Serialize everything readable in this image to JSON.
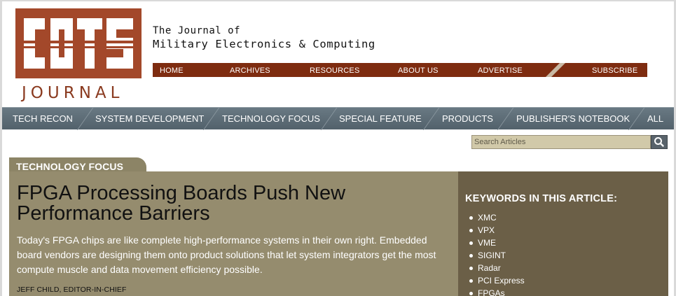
{
  "logo": {
    "main_text": "COTS",
    "sub_text": "JOURNAL",
    "brand_color": "#a3482a"
  },
  "tagline": {
    "line1": "The Journal of",
    "line2": "Military Electronics & Computing"
  },
  "topnav": {
    "items": [
      "HOME",
      "ARCHIVES",
      "RESOURCES",
      "ABOUT US",
      "ADVERTISE",
      "SUBSCRIBE"
    ],
    "bg_color": "#7e2c10"
  },
  "categories": {
    "items": [
      "TECH RECON",
      "SYSTEM DEVELOPMENT",
      "TECHNOLOGY FOCUS",
      "SPECIAL FEATURE",
      "PRODUCTS",
      "PUBLISHER'S NOTEBOOK",
      "ALL"
    ]
  },
  "search": {
    "placeholder": "Search Articles",
    "icon": "search-icon"
  },
  "section": {
    "label": "TECHNOLOGY FOCUS"
  },
  "article": {
    "title": "FPGA Processing Boards Push New Performance Barriers",
    "dek": "Today's FPGA chips are like complete high-performance systems in their own right. Embedded board vendors are designing them onto product solutions that let system integrators get the most compute muscle and data movement efficiency possible.",
    "byline": "JEFF CHILD, EDITOR-IN-CHIEF"
  },
  "keywords": {
    "heading": "KEYWORDS IN THIS ARTICLE:",
    "items": [
      "XMC",
      "VPX",
      "VME",
      "SIGINT",
      "Radar",
      "PCI Express",
      "FPGAs"
    ]
  }
}
